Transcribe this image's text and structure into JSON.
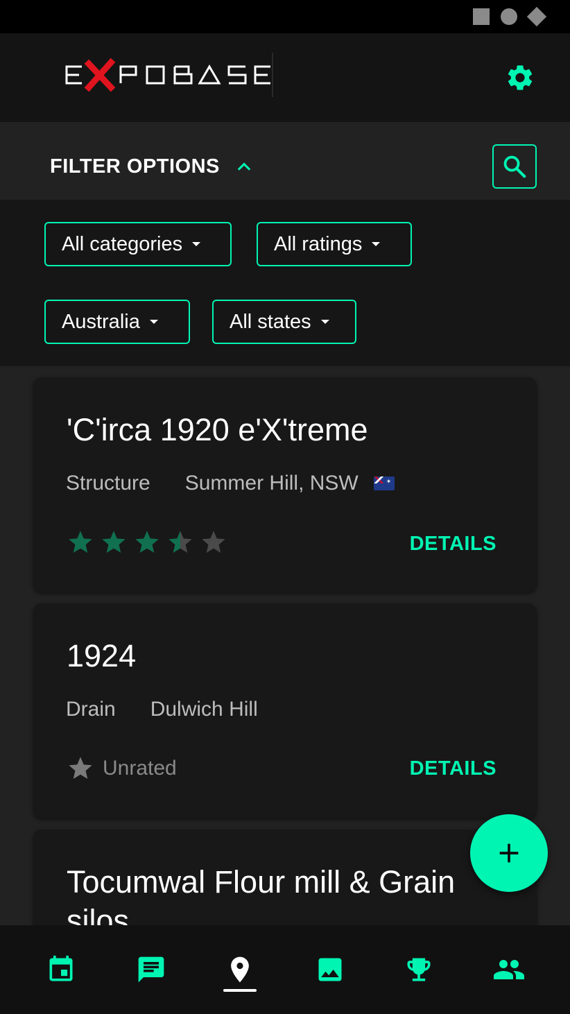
{
  "app": {
    "logo_text": "EXPOBASE",
    "accent_color": "#00f5b3",
    "logo_x_color": "#e0141e"
  },
  "status_bar": {
    "icons": [
      "square-icon",
      "circle-icon",
      "diamond-icon"
    ]
  },
  "header": {
    "settings_icon": "gear-icon"
  },
  "filter": {
    "title": "FILTER OPTIONS",
    "expanded": true,
    "toggle_icon": "chevron-up-icon",
    "search_icon": "search-icon",
    "dropdowns": [
      {
        "label": "All categories"
      },
      {
        "label": "All ratings"
      },
      {
        "label": "Australia"
      },
      {
        "label": "All states"
      }
    ]
  },
  "cards": [
    {
      "title": "'C'irca 1920 e'X'treme",
      "category": "Structure",
      "location": "Summer Hill, NSW",
      "flag": "australia-flag-icon",
      "rating": 3.5,
      "rating_max": 5,
      "action": "DETAILS"
    },
    {
      "title": "1924",
      "category": "Drain",
      "location": "Dulwich Hill",
      "rating_label": "Unrated",
      "action": "DETAILS"
    },
    {
      "title": "Tocumwal Flour mill & Grain silos"
    }
  ],
  "fab": {
    "icon": "plus-icon"
  },
  "bottom_nav": {
    "items": [
      {
        "icon": "calendar-icon"
      },
      {
        "icon": "chat-icon"
      },
      {
        "icon": "map-pin-icon",
        "selected": true
      },
      {
        "icon": "image-icon"
      },
      {
        "icon": "trophy-icon"
      },
      {
        "icon": "people-icon"
      }
    ]
  }
}
